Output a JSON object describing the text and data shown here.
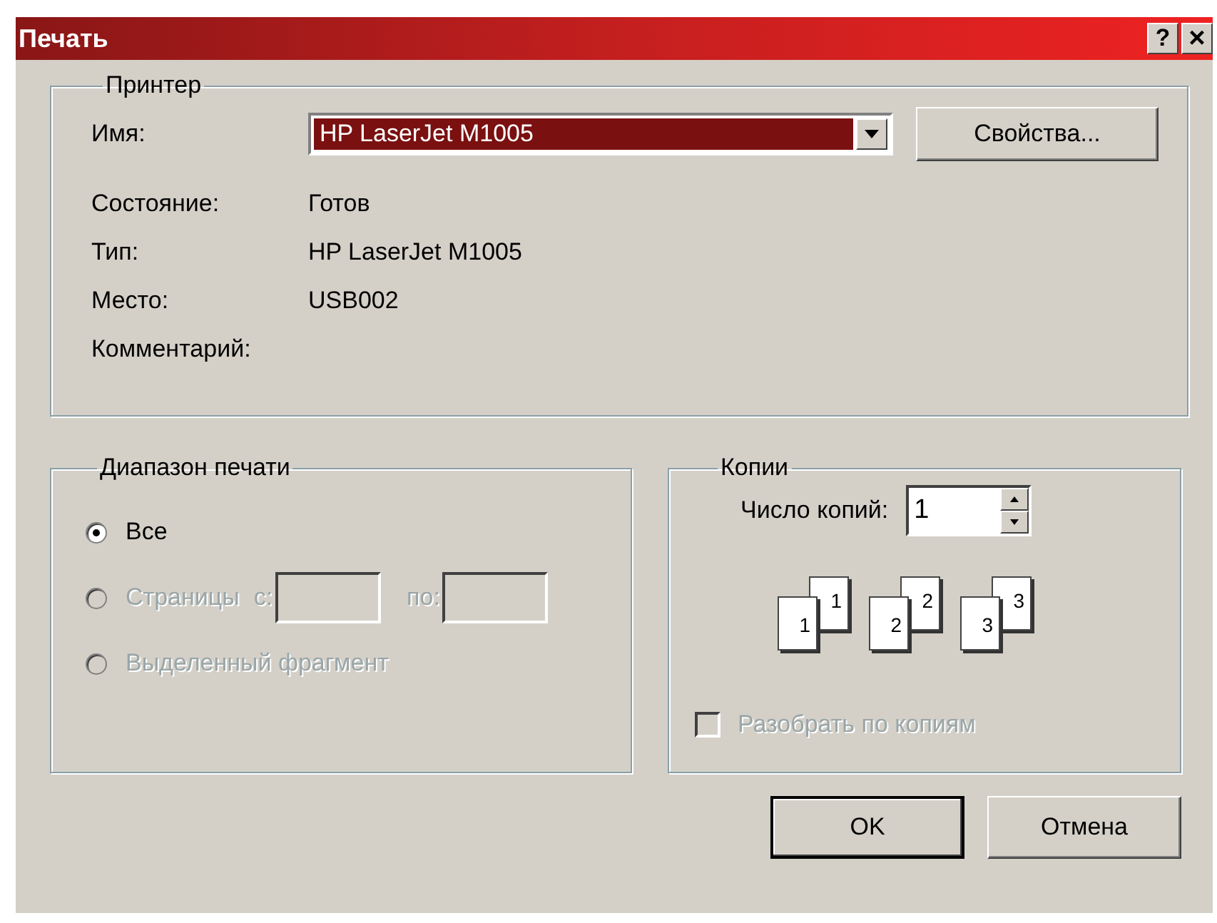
{
  "window": {
    "title": "Печать",
    "title_buttons": [
      {
        "kind": "help",
        "glyph": "?"
      },
      {
        "kind": "close",
        "glyph": "×"
      }
    ]
  },
  "printer": {
    "legend": "Принтер",
    "name_label": "Имя:",
    "name_value": "HP LaserJet M1005",
    "name_focused": true,
    "properties_button": "Свойства...",
    "info": [
      {
        "label": "Состояние:",
        "value": "Готов"
      },
      {
        "label": "Тип:",
        "value": "HP LaserJet M1005"
      },
      {
        "label": "Место:",
        "value": "USB002"
      },
      {
        "label": "Комментарий:"
      }
    ]
  },
  "range": {
    "legend": "Диапазон печати",
    "options": [
      {
        "kind": "plain",
        "label": "Все",
        "selected": true,
        "disabled": false
      },
      {
        "kind": "pages",
        "label": "Страницы",
        "from_label": "с:",
        "to_label": "по:",
        "selected": false,
        "disabled": true
      },
      {
        "kind": "plain",
        "label": "Выделенный фрагмент",
        "selected": false,
        "disabled": true
      }
    ]
  },
  "copies": {
    "legend": "Копии",
    "count_label": "Число копий:",
    "count": "1",
    "collate_pages": [
      {
        "front": "1",
        "back": "1"
      },
      {
        "front": "2",
        "back": "2"
      },
      {
        "front": "3",
        "back": "3"
      }
    ],
    "collate": {
      "label": "Разобрать по копиям",
      "checked": false,
      "disabled": true
    }
  },
  "buttons": [
    {
      "label": "OK",
      "default": true
    },
    {
      "label": "Отмена",
      "default": false
    }
  ]
}
